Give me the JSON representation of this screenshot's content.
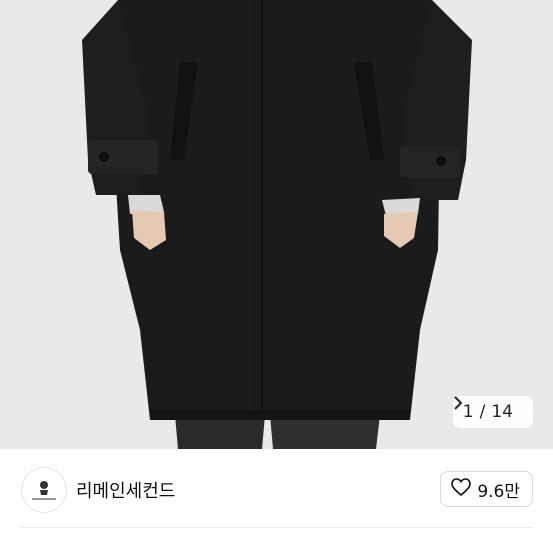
{
  "gallery": {
    "current_page": "1",
    "separator": "/",
    "total_pages": "14",
    "next_icon": "chevron-right-icon"
  },
  "seller": {
    "name": "리메인세컨드",
    "avatar_icon": "shop-logo-icon",
    "like_icon": "heart-outline-icon",
    "like_count": "9.6만"
  },
  "colors": {
    "background": "#e9e9e7",
    "coat": "#1b1b1c",
    "text": "#111111"
  }
}
